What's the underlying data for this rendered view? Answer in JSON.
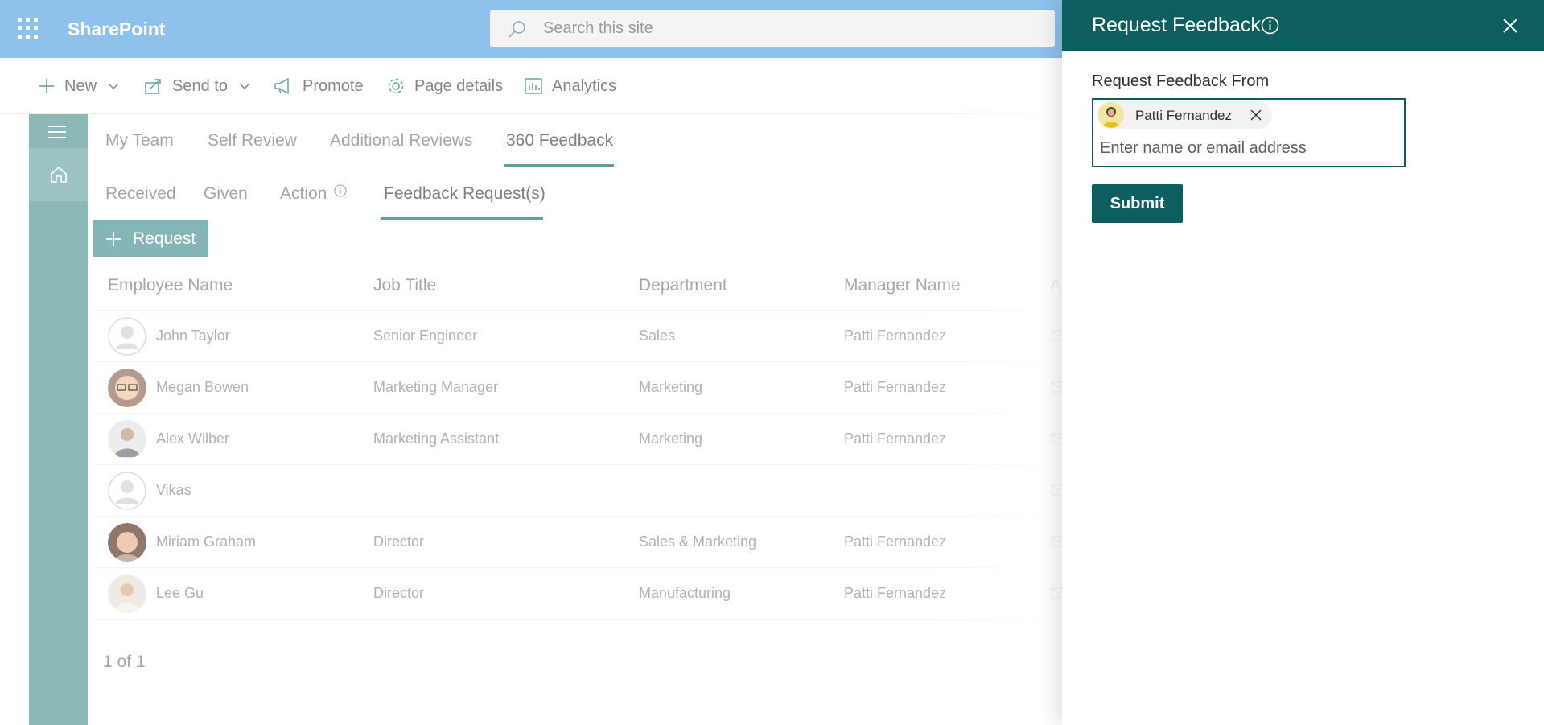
{
  "app": {
    "name": "SharePoint"
  },
  "search": {
    "placeholder": "Search this site"
  },
  "commandbar": {
    "new_label": "New",
    "send_to_label": "Send to",
    "promote_label": "Promote",
    "page_details_label": "Page details",
    "analytics_label": "Analytics"
  },
  "tabs": {
    "primary": [
      "My Team",
      "Self Review",
      "Additional Reviews",
      "360 Feedback"
    ],
    "primary_active": "360 Feedback",
    "secondary": [
      "Received",
      "Given",
      "Action",
      "Feedback Request(s)"
    ],
    "secondary_active": "Feedback Request(s)"
  },
  "request_button_label": "Request",
  "table": {
    "headers": [
      "Employee Name",
      "Job Title",
      "Department",
      "Manager Name",
      "Ac"
    ],
    "rows": [
      {
        "name": "John Taylor",
        "job": "Senior Engineer",
        "dept": "Sales",
        "manager": "Patti Fernandez",
        "avatar": "placeholder"
      },
      {
        "name": "Megan Bowen",
        "job": "Marketing Manager",
        "dept": "Marketing",
        "manager": "Patti Fernandez",
        "avatar": "photo"
      },
      {
        "name": "Alex Wilber",
        "job": "Marketing Assistant",
        "dept": "Marketing",
        "manager": "Patti Fernandez",
        "avatar": "photo"
      },
      {
        "name": "Vikas",
        "job": "",
        "dept": "",
        "manager": "",
        "avatar": "placeholder"
      },
      {
        "name": "Miriam Graham",
        "job": "Director",
        "dept": "Sales & Marketing",
        "manager": "Patti Fernandez",
        "avatar": "photo"
      },
      {
        "name": "Lee Gu",
        "job": "Director",
        "dept": "Manufacturing",
        "manager": "Patti Fernandez",
        "avatar": "photo"
      }
    ]
  },
  "pager": "1 of 1",
  "panel": {
    "title": "Request Feedback",
    "field_label": "Request Feedback From",
    "selected_person": "Patti Fernandez",
    "input_placeholder": "Enter name or email address",
    "submit_label": "Submit"
  },
  "colors": {
    "suitebar": "#68ace4",
    "leftnav": "#67a1a1",
    "panel_header": "#0d5e5e",
    "accent": "#2d7d7d"
  }
}
